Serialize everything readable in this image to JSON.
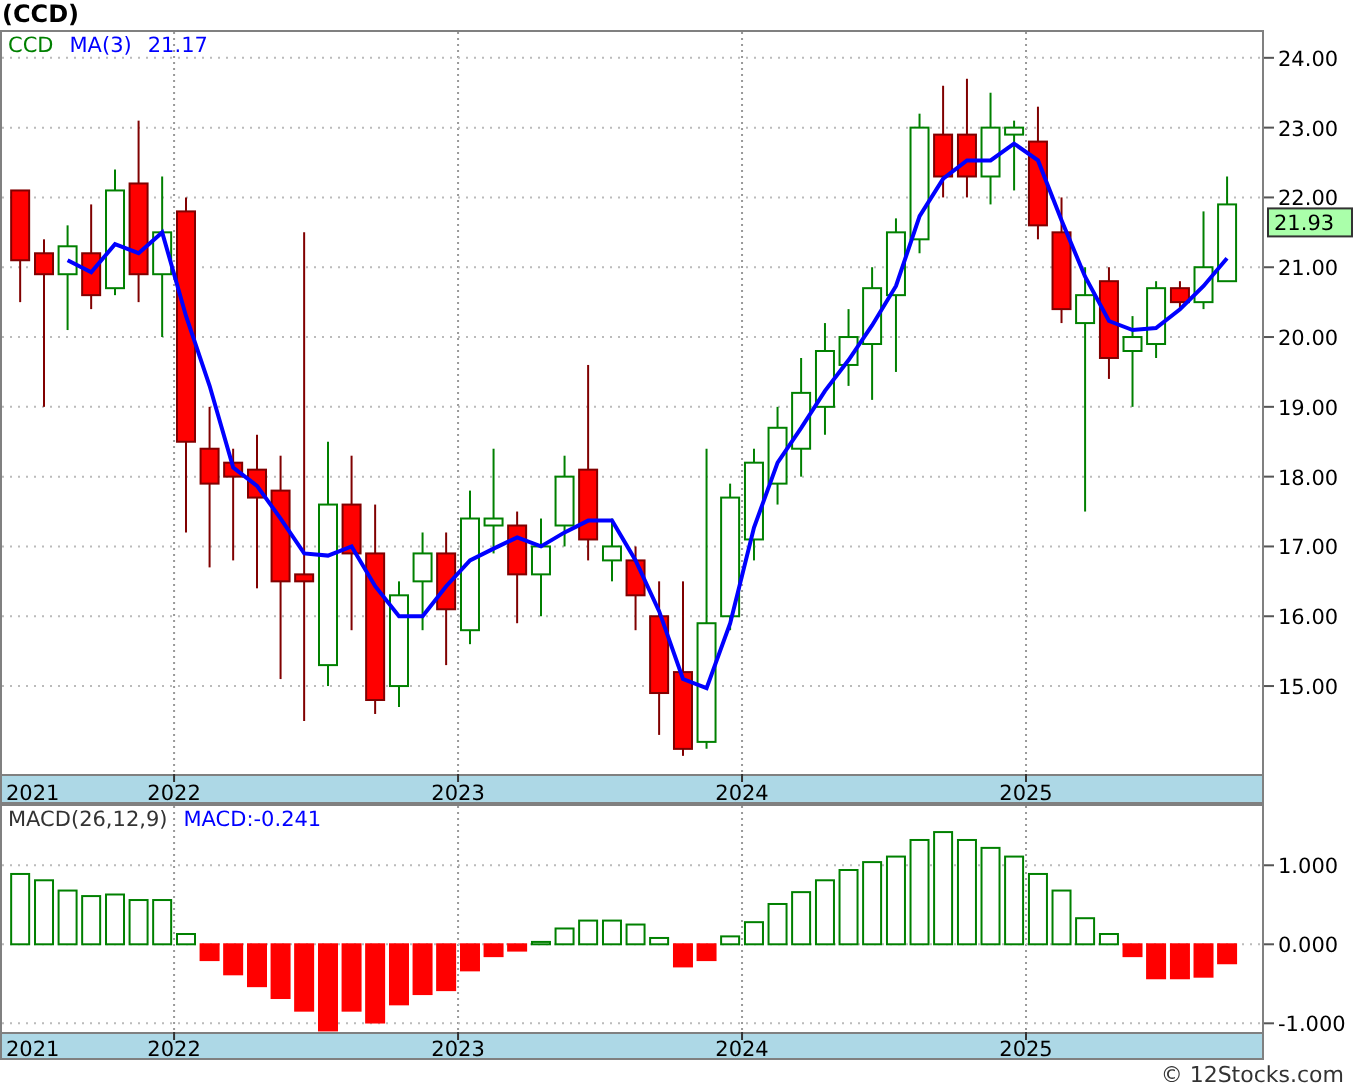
{
  "title": "(CCD)",
  "price_panel": {
    "ma_reading": "21.17",
    "last_price": "21.93",
    "axis_start_label": "2021",
    "chart_data": {
      "type": "candlestick",
      "title": "CCD",
      "grid": true,
      "ylim": [
        13.74,
        24.37
      ],
      "xlim": [
        2021.387,
        2025.838
      ],
      "x": [
        2021.458,
        2021.542,
        2021.625,
        2021.708,
        2021.792,
        2021.875,
        2021.958,
        2022.042,
        2022.125,
        2022.208,
        2022.292,
        2022.375,
        2022.458,
        2022.542,
        2022.625,
        2022.708,
        2022.792,
        2022.875,
        2022.958,
        2023.042,
        2023.125,
        2023.208,
        2023.292,
        2023.375,
        2023.458,
        2023.542,
        2023.625,
        2023.708,
        2023.792,
        2023.875,
        2023.958,
        2024.042,
        2024.125,
        2024.208,
        2024.292,
        2024.375,
        2024.458,
        2024.542,
        2024.625,
        2024.708,
        2024.792,
        2024.875,
        2024.958,
        2025.042,
        2025.125,
        2025.208,
        2025.292,
        2025.375,
        2025.458,
        2025.542,
        2025.625,
        2025.708
      ],
      "yticks": [
        {
          "value": 15,
          "label": "15.00"
        },
        {
          "value": 16,
          "label": "16.00"
        },
        {
          "value": 17,
          "label": "17.00"
        },
        {
          "value": 18,
          "label": "18.00"
        },
        {
          "value": 19,
          "label": "19.00"
        },
        {
          "value": 20,
          "label": "20.00"
        },
        {
          "value": 21,
          "label": "21.00"
        },
        {
          "value": 22,
          "label": "22.00"
        },
        {
          "value": 23,
          "label": "23.00"
        },
        {
          "value": 24,
          "label": "24.00"
        }
      ],
      "xticks": [
        {
          "value": 2022,
          "label": "2022"
        },
        {
          "value": 2023,
          "label": "2023"
        },
        {
          "value": 2024,
          "label": "2024"
        },
        {
          "value": 2025,
          "label": "2025"
        }
      ],
      "ohlc": [
        [
          22.1,
          22.1,
          20.5,
          21.1
        ],
        [
          21.2,
          21.4,
          19.0,
          20.9
        ],
        [
          20.9,
          21.6,
          20.1,
          21.3
        ],
        [
          21.2,
          21.9,
          20.4,
          20.6
        ],
        [
          20.7,
          22.4,
          20.6,
          22.1
        ],
        [
          22.2,
          23.1,
          20.5,
          20.9
        ],
        [
          20.9,
          22.3,
          20.0,
          21.5
        ],
        [
          21.8,
          22.0,
          17.2,
          18.5
        ],
        [
          18.4,
          19.0,
          16.7,
          17.9
        ],
        [
          18.2,
          18.4,
          16.8,
          18.0
        ],
        [
          18.1,
          18.6,
          16.4,
          17.7
        ],
        [
          17.8,
          18.3,
          15.1,
          16.5
        ],
        [
          16.6,
          21.5,
          14.5,
          16.5
        ],
        [
          15.3,
          18.5,
          15.0,
          17.6
        ],
        [
          17.6,
          18.3,
          15.8,
          16.9
        ],
        [
          16.9,
          17.6,
          14.6,
          14.8
        ],
        [
          15.0,
          16.5,
          14.7,
          16.3
        ],
        [
          16.5,
          17.2,
          15.8,
          16.9
        ],
        [
          16.9,
          17.2,
          15.3,
          16.1
        ],
        [
          15.8,
          17.8,
          15.6,
          17.4
        ],
        [
          17.3,
          18.4,
          16.9,
          17.4
        ],
        [
          17.3,
          17.5,
          15.9,
          16.6
        ],
        [
          16.6,
          17.4,
          16.0,
          17.0
        ],
        [
          17.3,
          18.3,
          17.0,
          18.0
        ],
        [
          18.1,
          19.6,
          16.8,
          17.1
        ],
        [
          16.8,
          17.4,
          16.5,
          17.0
        ],
        [
          16.8,
          17.0,
          15.8,
          16.3
        ],
        [
          16.0,
          16.5,
          14.3,
          14.9
        ],
        [
          15.2,
          16.5,
          14.0,
          14.1
        ],
        [
          14.2,
          18.4,
          14.1,
          15.9
        ],
        [
          16.0,
          17.9,
          15.8,
          17.7
        ],
        [
          17.1,
          18.4,
          16.8,
          18.2
        ],
        [
          17.9,
          19.0,
          17.6,
          18.7
        ],
        [
          18.4,
          19.7,
          18.0,
          19.2
        ],
        [
          19.0,
          20.2,
          18.6,
          19.8
        ],
        [
          19.6,
          20.4,
          19.3,
          20.0
        ],
        [
          19.9,
          21.0,
          19.1,
          20.7
        ],
        [
          20.6,
          21.7,
          19.5,
          21.5
        ],
        [
          21.4,
          23.2,
          21.2,
          23.0
        ],
        [
          22.9,
          23.6,
          22.0,
          22.3
        ],
        [
          22.9,
          23.7,
          22.0,
          22.3
        ],
        [
          22.3,
          23.5,
          21.9,
          23.0
        ],
        [
          22.9,
          23.1,
          22.1,
          23.0
        ],
        [
          22.8,
          23.3,
          21.4,
          21.6
        ],
        [
          21.5,
          22.0,
          20.2,
          20.4
        ],
        [
          20.2,
          21.0,
          17.5,
          20.6
        ],
        [
          20.8,
          21.0,
          19.4,
          19.7
        ],
        [
          19.8,
          20.3,
          19.0,
          20.0
        ],
        [
          19.9,
          20.8,
          19.7,
          20.7
        ],
        [
          20.7,
          20.8,
          20.4,
          20.5
        ],
        [
          20.5,
          21.8,
          20.4,
          21.0
        ],
        [
          20.8,
          22.3,
          20.8,
          21.9
        ]
      ],
      "series": [
        {
          "name": "MA(3)",
          "type": "line",
          "color": "#0000ff",
          "values": [
            null,
            null,
            21.1,
            20.93,
            21.33,
            21.2,
            21.5,
            20.3,
            19.3,
            18.13,
            17.87,
            17.4,
            16.9,
            16.87,
            17.0,
            16.43,
            16.0,
            16.0,
            16.43,
            16.8,
            16.97,
            17.13,
            17.0,
            17.2,
            17.37,
            17.37,
            16.8,
            16.07,
            15.1,
            14.97,
            15.9,
            17.27,
            18.2,
            18.7,
            19.23,
            19.67,
            20.17,
            20.73,
            21.73,
            22.27,
            22.53,
            22.53,
            22.77,
            22.53,
            21.67,
            20.87,
            20.23,
            20.1,
            20.13,
            20.4,
            20.73,
            21.13
          ]
        }
      ]
    }
  },
  "macd_panel": {
    "reading": "MACD:-0.241",
    "axis_start_label": "2021",
    "chart_data": {
      "type": "bar",
      "title": "MACD(26,12,9)",
      "grid": true,
      "ylim": [
        -1.11,
        1.75
      ],
      "xlim": [
        2021.387,
        2025.838
      ],
      "x": [
        2021.458,
        2021.542,
        2021.625,
        2021.708,
        2021.792,
        2021.875,
        2021.958,
        2022.042,
        2022.125,
        2022.208,
        2022.292,
        2022.375,
        2022.458,
        2022.542,
        2022.625,
        2022.708,
        2022.792,
        2022.875,
        2022.958,
        2023.042,
        2023.125,
        2023.208,
        2023.292,
        2023.375,
        2023.458,
        2023.542,
        2023.625,
        2023.708,
        2023.792,
        2023.875,
        2023.958,
        2024.042,
        2024.125,
        2024.208,
        2024.292,
        2024.375,
        2024.458,
        2024.542,
        2024.625,
        2024.708,
        2024.792,
        2024.875,
        2024.958,
        2025.042,
        2025.125,
        2025.208,
        2025.292,
        2025.375,
        2025.458,
        2025.542,
        2025.625,
        2025.708
      ],
      "yticks": [
        {
          "value": -1,
          "label": "-1.000"
        },
        {
          "value": 0,
          "label": "0.000"
        },
        {
          "value": 1,
          "label": "1.000"
        }
      ],
      "xticks": [
        {
          "value": 2022,
          "label": "2022"
        },
        {
          "value": 2023,
          "label": "2023"
        },
        {
          "value": 2024,
          "label": "2024"
        },
        {
          "value": 2025,
          "label": "2025"
        }
      ],
      "series": [
        {
          "color": "#008000",
          "values": [
            0.89,
            0.81,
            0.68,
            0.61,
            0.63,
            0.56,
            0.56,
            0.13,
            null,
            null,
            null,
            null,
            null,
            null,
            null,
            null,
            null,
            null,
            null,
            null,
            null,
            null,
            0.03,
            0.2,
            0.3,
            0.3,
            0.25,
            0.08,
            null,
            null,
            0.1,
            0.28,
            0.51,
            0.66,
            0.81,
            0.94,
            1.04,
            1.11,
            1.32,
            1.42,
            1.32,
            1.22,
            1.11,
            0.89,
            0.68,
            0.33,
            0.13,
            null,
            null,
            null,
            null,
            null
          ]
        },
        {
          "color": "#ff0000",
          "values": [
            null,
            null,
            null,
            null,
            null,
            null,
            null,
            null,
            -0.2,
            -0.38,
            -0.53,
            -0.68,
            -0.84,
            -1.09,
            -0.84,
            -0.99,
            -0.76,
            -0.63,
            -0.58,
            -0.33,
            -0.15,
            -0.08,
            null,
            null,
            null,
            null,
            null,
            null,
            -0.28,
            -0.2,
            null,
            null,
            null,
            null,
            null,
            null,
            null,
            null,
            null,
            null,
            null,
            null,
            null,
            null,
            null,
            null,
            null,
            -0.15,
            -0.43,
            -0.43,
            -0.41,
            -0.24
          ]
        }
      ]
    }
  },
  "credit": "© 12Stocks.com"
}
